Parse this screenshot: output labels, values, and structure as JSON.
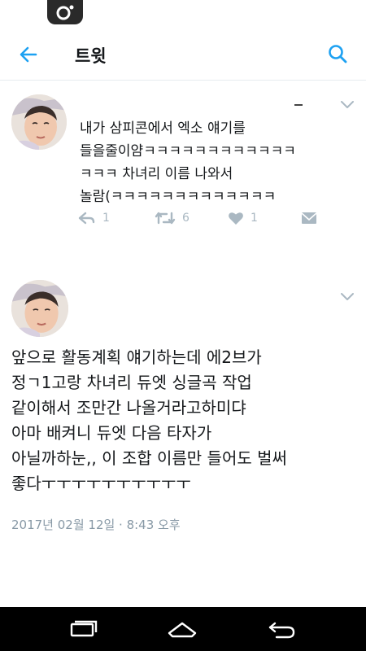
{
  "header": {
    "title": "트윗"
  },
  "tweet1": {
    "text": "내가 삼피콘에서 엑소 얘기를\n들을줄이얌ㅋㅋㅋㅋㅋㅋㅋㅋㅋㅋㅋㅋ\nㅋㅋㅋ 차녀리 이름 나와서\n놀람(ㅋㅋㅋㅋㅋㅋㅋㅋㅋㅋㅋㅋㅋ",
    "reply_count": "1",
    "retweet_count": "6",
    "like_count": "1"
  },
  "tweet2": {
    "text": "앞으로 활동계획 얘기하는데 에2브가\n정ㄱ1고랑 차녀리 듀엣 싱글곡 작업\n같이해서 조만간 나올거라고하미댜\n아마 배켜니 듀엣 다음 타자가\n아닐까하눈,, 이 조합 이름만 들어도 벌써\n좋다ㅜㅜㅜㅜㅜㅜㅜㅜㅜㅜ",
    "timestamp": "2017년 02월 12일 · 8:43 오후"
  },
  "colors": {
    "accent": "#1da1f2",
    "muted": "#aab8c2",
    "text": "#14171a",
    "navbar": "#000000"
  }
}
